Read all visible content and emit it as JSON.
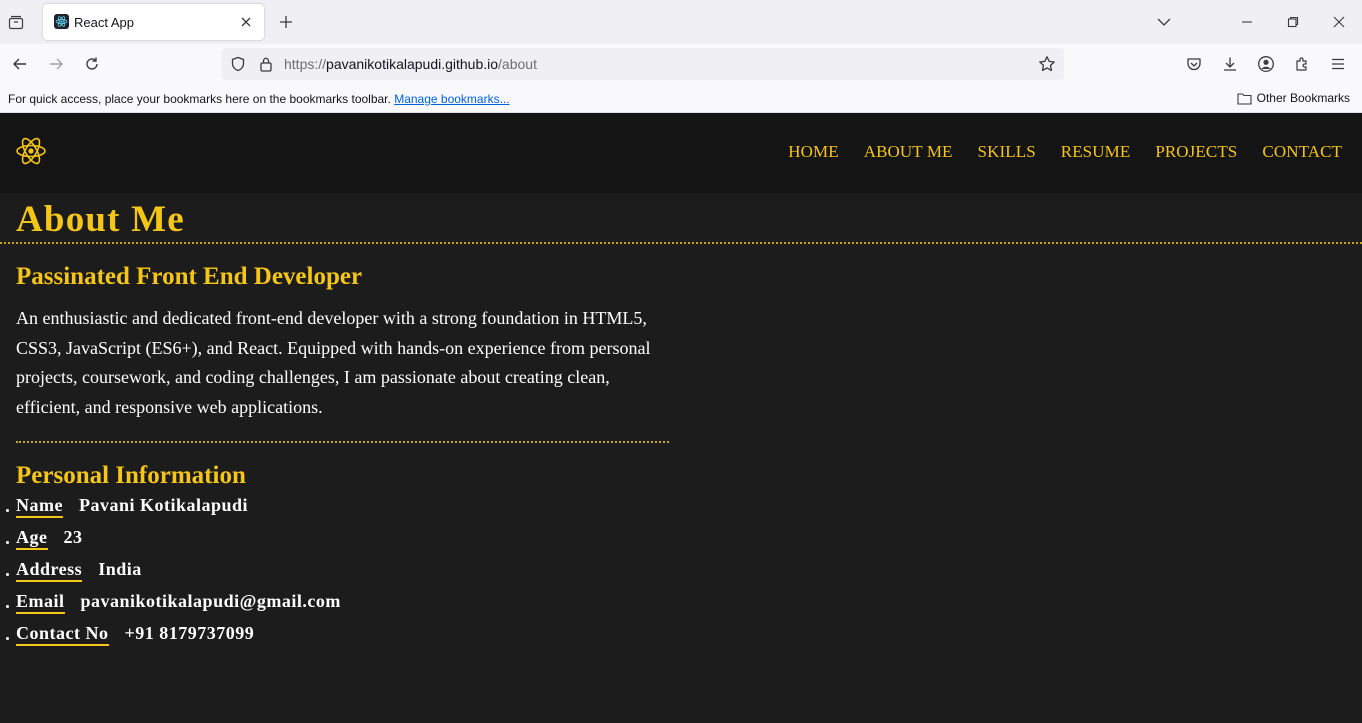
{
  "browser": {
    "tab_title": "React App",
    "url_prefix": "https://",
    "url_host": "pavanikotikalapudi.github.io",
    "url_path": "/about",
    "bookmarks_text": "For quick access, place your bookmarks here on the bookmarks toolbar.",
    "bookmarks_link": "Manage bookmarks...",
    "other_bookmarks": "Other Bookmarks"
  },
  "site": {
    "nav": [
      "HOME",
      "ABOUT ME",
      "SKILLS",
      "RESUME",
      "PROJECTS",
      "CONTACT"
    ],
    "page_title": "About Me",
    "subtitle": "Passinated Front End Developer",
    "intro": "An enthusiastic and dedicated front-end developer with a strong foundation in HTML5, CSS3, JavaScript (ES6+), and React. Equipped with hands-on experience from personal projects, coursework, and coding challenges, I am passionate about creating clean, efficient, and responsive web applications.",
    "personal_title": "Personal Information",
    "info": [
      {
        "label": "Name",
        "value": "Pavani Kotikalapudi"
      },
      {
        "label": "Age",
        "value": "23"
      },
      {
        "label": "Address",
        "value": "India"
      },
      {
        "label": "Email",
        "value": "pavanikotikalapudi@gmail.com"
      },
      {
        "label": "Contact No",
        "value": "+91 8179737099"
      }
    ]
  },
  "colors": {
    "accent": "#f5c518",
    "page_bg": "#1c1c1c",
    "header_bg": "#141414"
  }
}
